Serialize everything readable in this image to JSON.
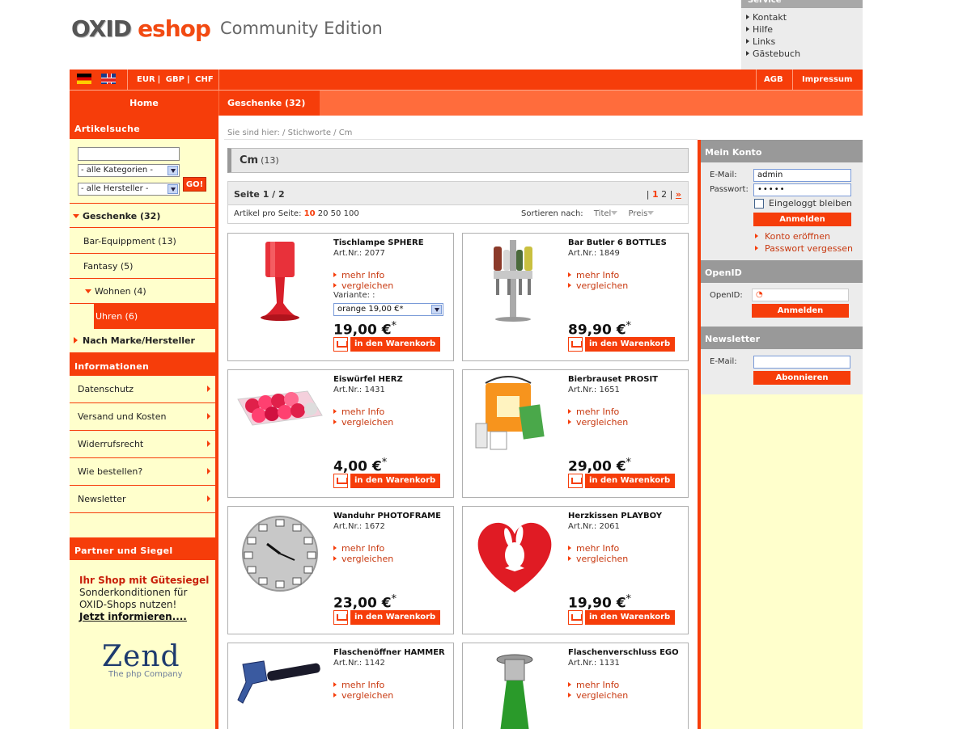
{
  "logo": {
    "part1": "OXID",
    "part2": "eshop",
    "part3": "Community Edition"
  },
  "service": {
    "title": "Service",
    "items": [
      "Kontakt",
      "Hilfe",
      "Links",
      "Gästebuch"
    ]
  },
  "topbar": {
    "currencies": [
      "EUR",
      "GBP",
      "CHF"
    ],
    "links": [
      "AGB",
      "Impressum"
    ]
  },
  "nav": {
    "home": "Home",
    "category": "Geschenke (32)"
  },
  "search": {
    "title": "Artikelsuche",
    "category_select": "- alle Kategorien -",
    "manufacturer_select": "- alle Hersteller -",
    "go": "GO!"
  },
  "categories": [
    {
      "label": "Geschenke (32)",
      "bold": true
    },
    {
      "label": "Bar-Equippment (13)"
    },
    {
      "label": "Fantasy (5)"
    },
    {
      "label": "Wohnen (4)"
    },
    {
      "label": "Uhren (6)"
    },
    {
      "label": "Nach Marke/Hersteller",
      "bold": true
    }
  ],
  "information": {
    "title": "Informationen",
    "items": [
      "Datenschutz",
      "Versand und Kosten",
      "Widerrufsrecht",
      "Wie bestellen?",
      "Newsletter"
    ]
  },
  "partner": {
    "title": "Partner und Siegel",
    "line1": "Ihr Shop mit Gütesiegel",
    "line2": "Sonderkonditionen für",
    "line3": "OXID-Shops nutzen!",
    "line4": "Jetzt informieren....",
    "zend": "Zend",
    "zend_sub": "The php Company"
  },
  "breadcrumb": "Sie sind hier: / Stichworte / Cm",
  "listing": {
    "title": "Cm",
    "count": "(13)",
    "page_label": "Seite 1 / 2",
    "pager": {
      "sep1": "|",
      "current": "1",
      "page2": "2",
      "sep2": "|",
      "next": "»"
    },
    "per_page_label": "Artikel pro Seite:",
    "per_page_options": [
      "10",
      "20",
      "50",
      "100"
    ],
    "sort_label": "Sortieren nach:",
    "sort_title": "Titel",
    "sort_price": "Preis"
  },
  "product_labels": {
    "more_info": "mehr Info",
    "compare": "vergleichen",
    "to_cart": "in den Warenkorb",
    "variant": "Variante: :"
  },
  "products": [
    {
      "name": "Tischlampe SPHERE",
      "artnr": "Art.Nr.: 2077",
      "price": "19,00 €",
      "star": "*",
      "variant": "orange 19,00 €*"
    },
    {
      "name": "Bar Butler 6 BOTTLES",
      "artnr": "Art.Nr.: 1849",
      "price": "89,90 €",
      "star": "*"
    },
    {
      "name": "Eiswürfel HERZ",
      "artnr": "Art.Nr.: 1431",
      "price": "4,00 €",
      "star": "*"
    },
    {
      "name": "Bierbrauset PROSIT",
      "artnr": "Art.Nr.: 1651",
      "price": "29,00 €",
      "star": "*"
    },
    {
      "name": "Wanduhr PHOTOFRAME",
      "artnr": "Art.Nr.: 1672",
      "price": "23,00 €",
      "star": "*"
    },
    {
      "name": "Herzkissen PLAYBOY",
      "artnr": "Art.Nr.: 2061",
      "price": "19,90 €",
      "star": "*"
    },
    {
      "name": "Flaschenöffner HAMMER",
      "artnr": "Art.Nr.: 1142"
    },
    {
      "name": "Flaschenverschluss EGO",
      "artnr": "Art.Nr.: 1131"
    }
  ],
  "account": {
    "title": "Mein Konto",
    "email_label": "E-Mail:",
    "email_value": "admin",
    "password_label": "Passwort:",
    "password_value": "•••••",
    "remember": "Eingeloggt bleiben",
    "login": "Anmelden",
    "open_account": "Konto eröffnen",
    "forgot": "Passwort vergessen"
  },
  "openid": {
    "title": "OpenID",
    "label": "OpenID:",
    "login": "Anmelden"
  },
  "newsletter": {
    "title": "Newsletter",
    "email_label": "E-Mail:",
    "subscribe": "Abonnieren"
  },
  "colors": {
    "accent": "#f63d0a",
    "nav_light": "#ff6c3c",
    "sidebar_bg": "#ffffcc",
    "box_gray": "#999999"
  }
}
